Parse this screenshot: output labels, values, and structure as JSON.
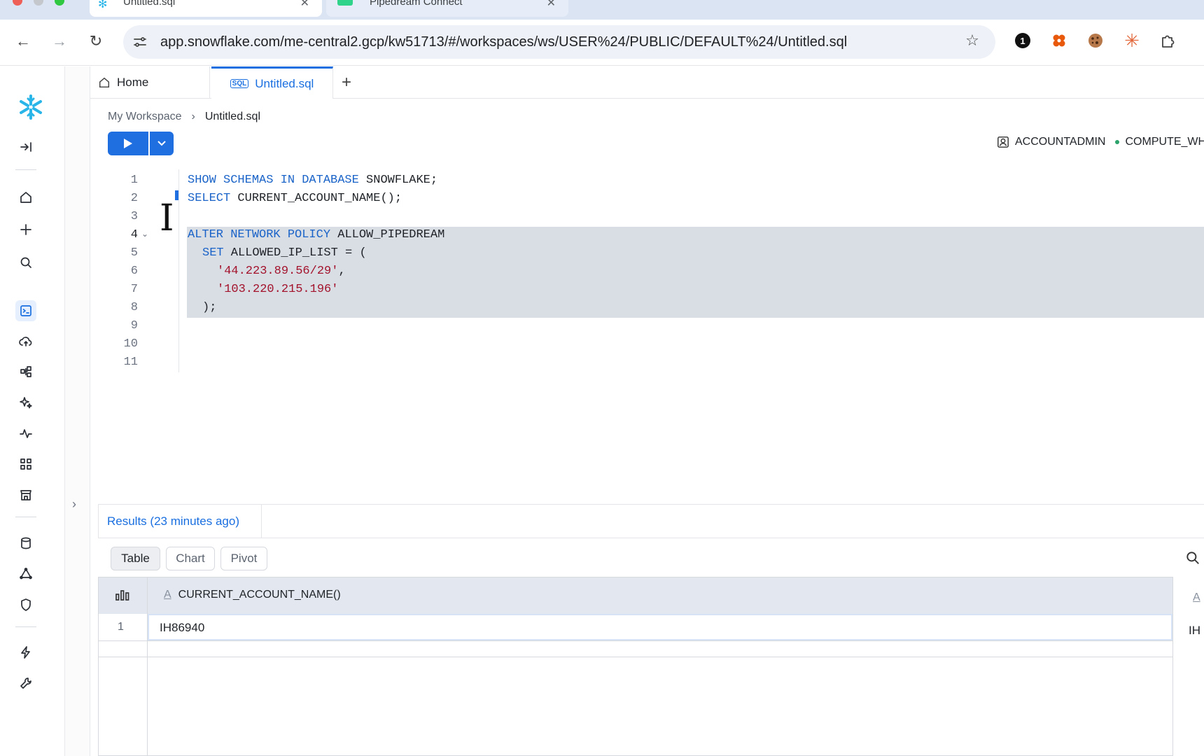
{
  "browser": {
    "tabs": [
      {
        "title": "Untitled.sql",
        "favicon": "snowflake-icon"
      },
      {
        "title": "Pipedream Connect",
        "favicon": "pipedream-icon"
      }
    ],
    "url": "app.snowflake.com/me-central2.gcp/kw51713/#/workspaces/ws/USER%24/PUBLIC/DEFAULT%24/Untitled.sql",
    "extensions": [
      "onepassword-icon",
      "flower-extension-icon",
      "cookie-icon",
      "claude-icon",
      "puzzle-icon"
    ]
  },
  "app": {
    "brand_color": "#29b5e8",
    "accent_color": "#1f6fe0",
    "tabs": {
      "home": "Home",
      "sql": "Untitled.sql"
    },
    "breadcrumb": {
      "root": "My Workspace",
      "current": "Untitled.sql"
    },
    "context": {
      "role": "ACCOUNTADMIN",
      "warehouse": "COMPUTE_WH"
    },
    "editor": {
      "lines": [
        "1",
        "2",
        "3",
        "4",
        "5",
        "6",
        "7",
        "8",
        "9",
        "10",
        "11"
      ],
      "code": {
        "l1_kw": "SHOW SCHEMAS IN DATABASE",
        "l1_rest": " SNOWFLAKE;",
        "l2_kw": "SELECT",
        "l2_rest": " CURRENT_ACCOUNT_NAME();",
        "l4_kw": "ALTER NETWORK POLICY",
        "l4_rest": " ALLOW_PIPEDREAM",
        "l5_kw": "SET",
        "l5_rest": " ALLOWED_IP_LIST = (",
        "l6_str": "'44.223.89.56/29'",
        "l6_rest": ",",
        "l7_str": "'103.220.215.196'",
        "l8": ");"
      }
    },
    "results": {
      "tab": "Results (23 minutes ago)",
      "views": [
        "Table",
        "Chart",
        "Pivot"
      ],
      "active_view": "Table",
      "columns": [
        "CURRENT_ACCOUNT_NAME()"
      ],
      "rows": [
        {
          "num": "1",
          "value": "IH86940"
        }
      ],
      "clipped_col_type": "A",
      "clipped_cell": "IH"
    }
  }
}
